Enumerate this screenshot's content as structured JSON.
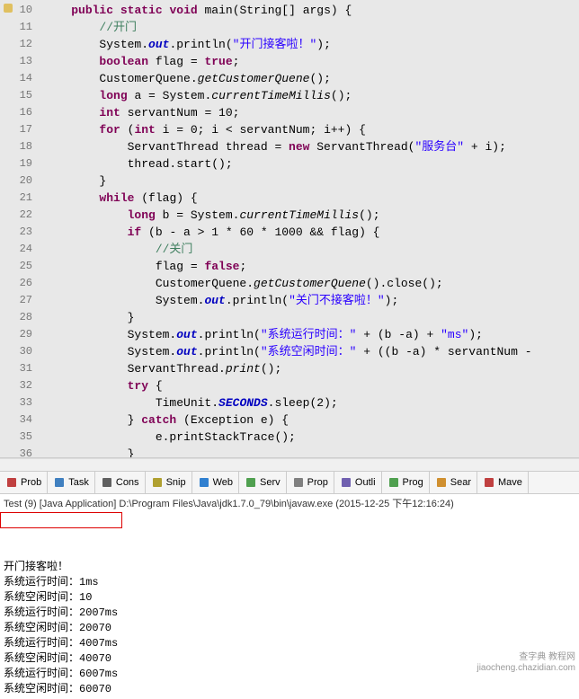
{
  "gutter": {
    "start": 10,
    "end": 36
  },
  "code_lines": [
    [
      [
        "kw",
        "public"
      ],
      [
        "",
        " "
      ],
      [
        "kw",
        "static"
      ],
      [
        "",
        " "
      ],
      [
        "kw",
        "void"
      ],
      [
        "",
        " main(String[] args) {"
      ]
    ],
    [
      [
        "",
        "    "
      ],
      [
        "cmt",
        "//开门"
      ]
    ],
    [
      [
        "",
        "    System."
      ],
      [
        "sfld",
        "out"
      ],
      [
        "",
        ".println("
      ],
      [
        "str",
        "\"开门接客啦！\""
      ],
      [
        "",
        ");"
      ]
    ],
    [
      [
        "",
        "    "
      ],
      [
        "kw",
        "boolean"
      ],
      [
        "",
        " flag = "
      ],
      [
        "kw",
        "true"
      ],
      [
        "",
        ";"
      ]
    ],
    [
      [
        "",
        "    CustomerQuene."
      ],
      [
        "mth",
        "getCustomerQuene"
      ],
      [
        "",
        "();"
      ]
    ],
    [
      [
        "",
        "    "
      ],
      [
        "kw",
        "long"
      ],
      [
        "",
        " a = System."
      ],
      [
        "mth",
        "currentTimeMillis"
      ],
      [
        "",
        "();"
      ]
    ],
    [
      [
        "",
        "    "
      ],
      [
        "kw",
        "int"
      ],
      [
        "",
        " servantNum = 10;"
      ]
    ],
    [
      [
        "",
        "    "
      ],
      [
        "kw",
        "for"
      ],
      [
        "",
        " ("
      ],
      [
        "kw",
        "int"
      ],
      [
        "",
        " i = 0; i < servantNum; i++) {"
      ]
    ],
    [
      [
        "",
        "        ServantThread thread = "
      ],
      [
        "kw",
        "new"
      ],
      [
        "",
        " ServantThread("
      ],
      [
        "str",
        "\"服务台\""
      ],
      [
        "",
        " + i);"
      ]
    ],
    [
      [
        "",
        "        thread.start();"
      ]
    ],
    [
      [
        "",
        "    }"
      ]
    ],
    [
      [
        "",
        "    "
      ],
      [
        "kw",
        "while"
      ],
      [
        "",
        " (flag) {"
      ]
    ],
    [
      [
        "",
        "        "
      ],
      [
        "kw",
        "long"
      ],
      [
        "",
        " b = System."
      ],
      [
        "mth",
        "currentTimeMillis"
      ],
      [
        "",
        "();"
      ]
    ],
    [
      [
        "",
        "        "
      ],
      [
        "kw",
        "if"
      ],
      [
        "",
        " (b - a > 1 * 60 * 1000 && flag) {"
      ]
    ],
    [
      [
        "",
        "            "
      ],
      [
        "cmt",
        "//关门"
      ]
    ],
    [
      [
        "",
        "            flag = "
      ],
      [
        "kw",
        "false"
      ],
      [
        "",
        ";"
      ]
    ],
    [
      [
        "",
        "            CustomerQuene."
      ],
      [
        "mth",
        "getCustomerQuene"
      ],
      [
        "",
        "().close();"
      ]
    ],
    [
      [
        "",
        "            System."
      ],
      [
        "sfld",
        "out"
      ],
      [
        "",
        ".println("
      ],
      [
        "str",
        "\"关门不接客啦！\""
      ],
      [
        "",
        ");"
      ]
    ],
    [
      [
        "",
        "        }"
      ]
    ],
    [
      [
        "",
        "        System."
      ],
      [
        "sfld",
        "out"
      ],
      [
        "",
        ".println("
      ],
      [
        "str",
        "\"系统运行时间：\""
      ],
      [
        "",
        " + (b -a) + "
      ],
      [
        "str",
        "\"ms\""
      ],
      [
        "",
        ");"
      ]
    ],
    [
      [
        "",
        "        System."
      ],
      [
        "sfld",
        "out"
      ],
      [
        "",
        ".println("
      ],
      [
        "str",
        "\"系统空闲时间：\""
      ],
      [
        "",
        " + ((b -a) * servantNum -"
      ]
    ],
    [
      [
        "",
        "        ServantThread."
      ],
      [
        "mth",
        "print"
      ],
      [
        "",
        "();"
      ]
    ],
    [
      [
        "",
        "        "
      ],
      [
        "kw",
        "try"
      ],
      [
        "",
        " {"
      ]
    ],
    [
      [
        "",
        "            TimeUnit."
      ],
      [
        "sfld",
        "SECONDS"
      ],
      [
        "",
        ".sleep(2);"
      ]
    ],
    [
      [
        "",
        "        } "
      ],
      [
        "kw",
        "catch"
      ],
      [
        "",
        " (Exception e) {"
      ]
    ],
    [
      [
        "",
        "            e.printStackTrace();"
      ]
    ],
    [
      [
        "",
        "        }"
      ]
    ]
  ],
  "tabs": [
    "Prob",
    "Task",
    "Cons",
    "Snip",
    "Web",
    "Serv",
    "Prop",
    "Outli",
    "Prog",
    "Sear",
    "Mave"
  ],
  "console_header": "Test (9) [Java Application] D:\\Program Files\\Java\\jdk1.7.0_79\\bin\\javaw.exe (2015-12-25 下午12:16:24)",
  "console_lines": [
    "开门接客啦！",
    "系统运行时间：1ms",
    "系统空闲时间：10",
    "系统运行时间：2007ms",
    "系统空闲时间：20070",
    "系统运行时间：4007ms",
    "系统空闲时间：40070",
    "系统运行时间：6007ms",
    "系统空闲时间：60070"
  ],
  "watermark": {
    "l1": "查字典 教程网",
    "l2": "jiaocheng.chazidian.com"
  },
  "tab_icons": {
    "Prob": "#c04040",
    "Task": "#4080c0",
    "Cons": "#606060",
    "Snip": "#b0a030",
    "Web": "#3080d0",
    "Serv": "#50a050",
    "Prop": "#808080",
    "Outli": "#7060b0",
    "Prog": "#50a050",
    "Sear": "#d09030",
    "Mave": "#c04040"
  }
}
